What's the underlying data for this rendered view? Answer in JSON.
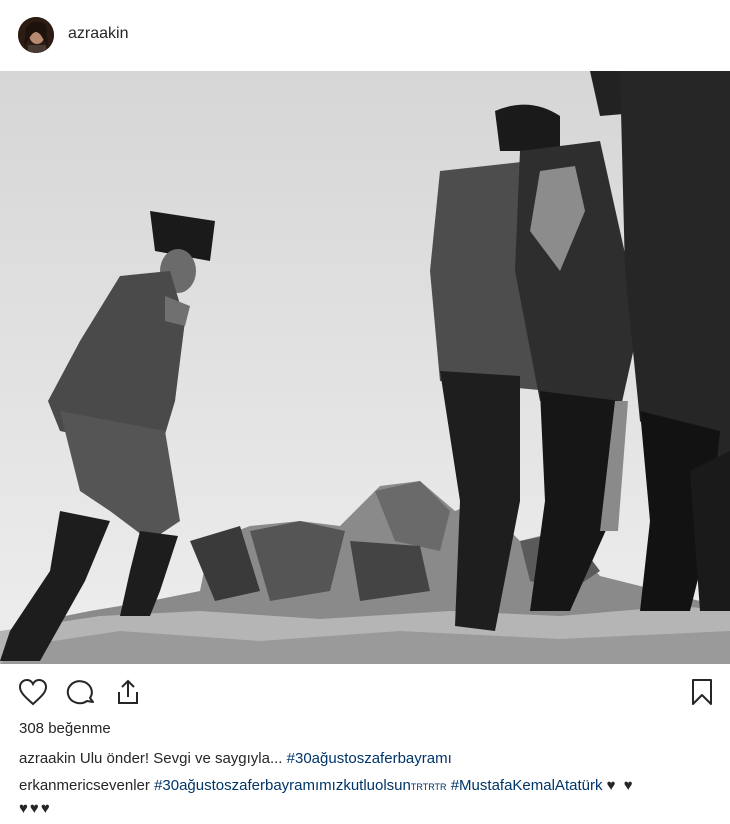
{
  "post": {
    "username": "azraakin",
    "likes_text": "308 beğenme"
  },
  "icons": {
    "like": "heart-outline-icon",
    "comment": "speech-bubble-icon",
    "share": "share-upload-icon",
    "save": "bookmark-icon"
  },
  "comments": [
    {
      "username": "azraakin",
      "text": "Ulu önder! Sevgi ve saygıyla...",
      "hashtags": "#30ağustoszaferbayramı"
    },
    {
      "username": "erkanmericsevenler",
      "hashtags": "#30ağustoszaferbayramımızkutluolsun",
      "small_text": "TRTRTR",
      "hashtags2": "#MustafaKemalAtatürk",
      "hearts_inline": "♥ ♥",
      "hearts_line2": "♥♥♥"
    }
  ]
}
